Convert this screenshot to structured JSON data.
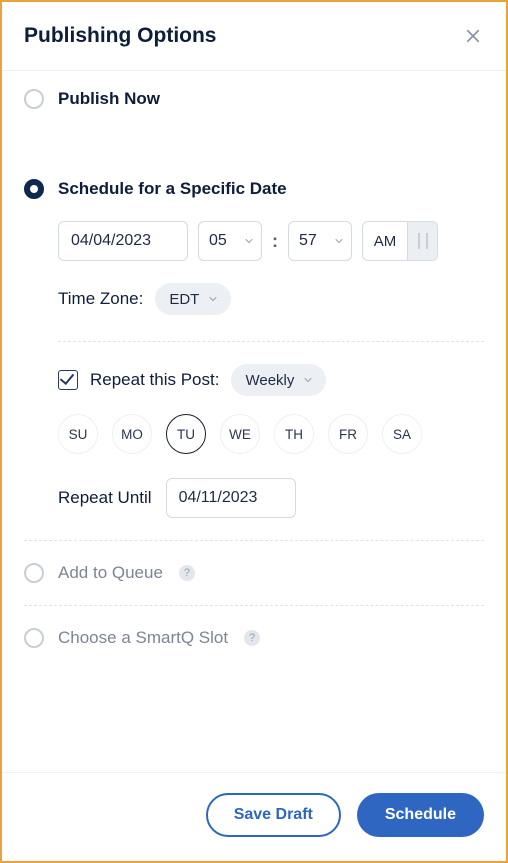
{
  "header": {
    "title": "Publishing Options"
  },
  "options": {
    "publish_now": {
      "label": "Publish Now",
      "selected": false
    },
    "schedule": {
      "label": "Schedule for a Specific Date",
      "selected": true,
      "date": "04/04/2023",
      "hour": "05",
      "minute": "57",
      "ampm": "AM",
      "time_zone_label": "Time Zone:",
      "time_zone_value": "EDT",
      "repeat": {
        "checkbox_label": "Repeat this Post:",
        "checked": true,
        "frequency": "Weekly",
        "days": {
          "su": "SU",
          "mo": "MO",
          "tu": "TU",
          "we": "WE",
          "th": "TH",
          "fr": "FR",
          "sa": "SA"
        },
        "selected_day": "tu",
        "until_label": "Repeat Until",
        "until_date": "04/11/2023"
      }
    },
    "add_to_queue": {
      "label": "Add to Queue",
      "selected": false
    },
    "smartq": {
      "label": "Choose a SmartQ Slot",
      "selected": false
    }
  },
  "footer": {
    "save_draft": "Save Draft",
    "schedule": "Schedule"
  }
}
